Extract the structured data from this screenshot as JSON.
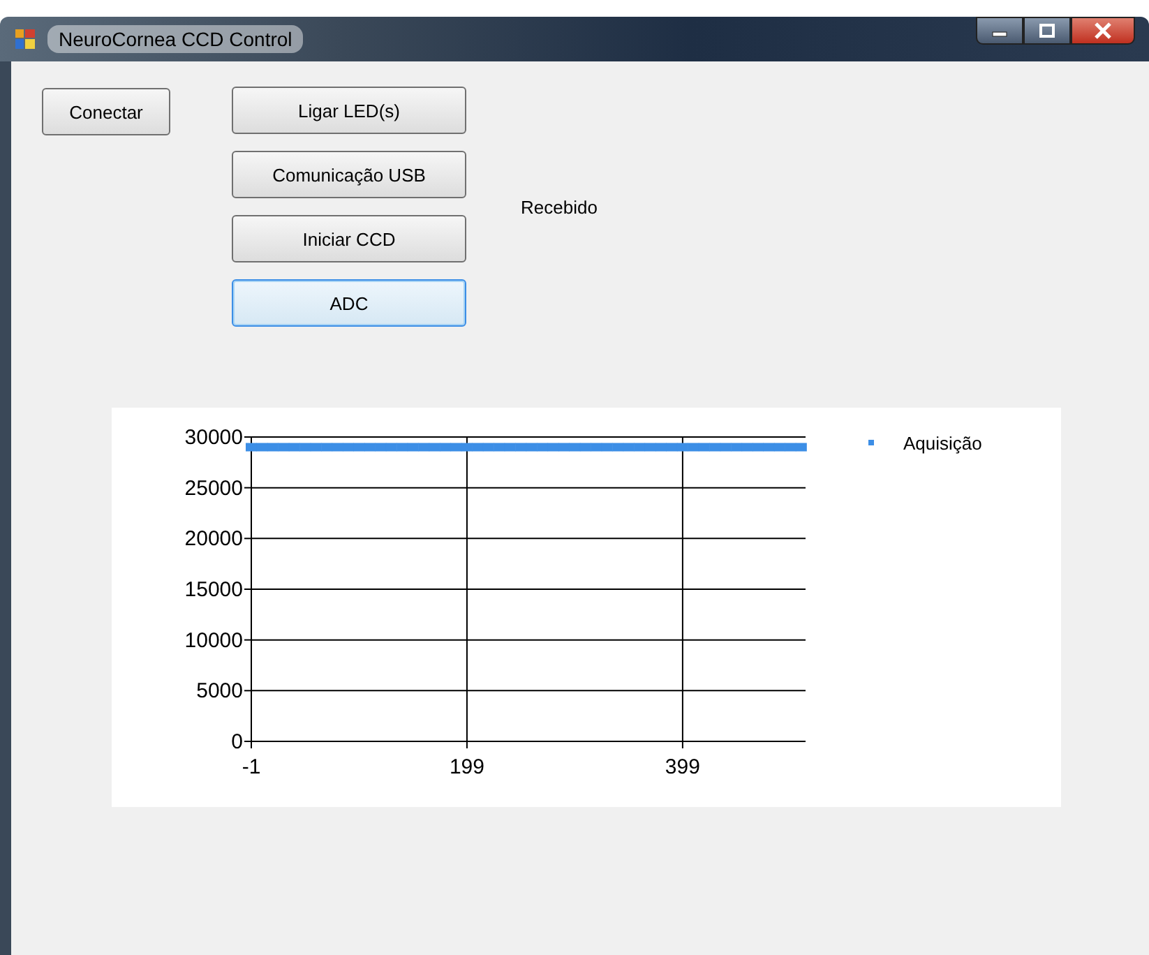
{
  "window": {
    "title": "NeuroCornea CCD Control"
  },
  "connect_button": {
    "label": "Conectar"
  },
  "action_buttons": [
    {
      "label": "Ligar LED(s)",
      "focused": false
    },
    {
      "label": "Comunicação USB",
      "focused": false
    },
    {
      "label": "Iniciar CCD",
      "focused": false
    },
    {
      "label": "ADC",
      "focused": true
    }
  ],
  "received_label": "Recebido",
  "chart": {
    "chart_data": {
      "type": "scatter",
      "x": [
        -1,
        9,
        19,
        29,
        39,
        49,
        59,
        69,
        79,
        89,
        99,
        109,
        119,
        129,
        139,
        149,
        159,
        169,
        179,
        189,
        199,
        209,
        219,
        229,
        239,
        249,
        259,
        269,
        279,
        289,
        299,
        309,
        319,
        329,
        339,
        349,
        359,
        369,
        379,
        389,
        399,
        409,
        419,
        429,
        439,
        449,
        459,
        469,
        479,
        489,
        499,
        509
      ],
      "series": [
        {
          "name": "Aquisição",
          "color": "#3c8ee6",
          "values": [
            29000,
            29000,
            29000,
            29000,
            29000,
            29000,
            29000,
            29000,
            29000,
            29000,
            29000,
            29000,
            29000,
            29000,
            29000,
            29000,
            29000,
            29000,
            29000,
            29000,
            29000,
            29000,
            29000,
            29000,
            29000,
            29000,
            29000,
            29000,
            29000,
            29000,
            29000,
            29000,
            29000,
            29000,
            29000,
            29000,
            29000,
            29000,
            29000,
            29000,
            29000,
            29000,
            29000,
            29000,
            29000,
            29000,
            29000,
            29000,
            29000,
            29000,
            29000,
            29000
          ]
        }
      ],
      "grid": true,
      "xlim": [
        -1,
        513
      ],
      "ylim": [
        0,
        30000
      ],
      "xticks": [
        -1,
        199,
        399
      ],
      "yticks": [
        0,
        5000,
        10000,
        15000,
        20000,
        25000,
        30000
      ]
    }
  }
}
